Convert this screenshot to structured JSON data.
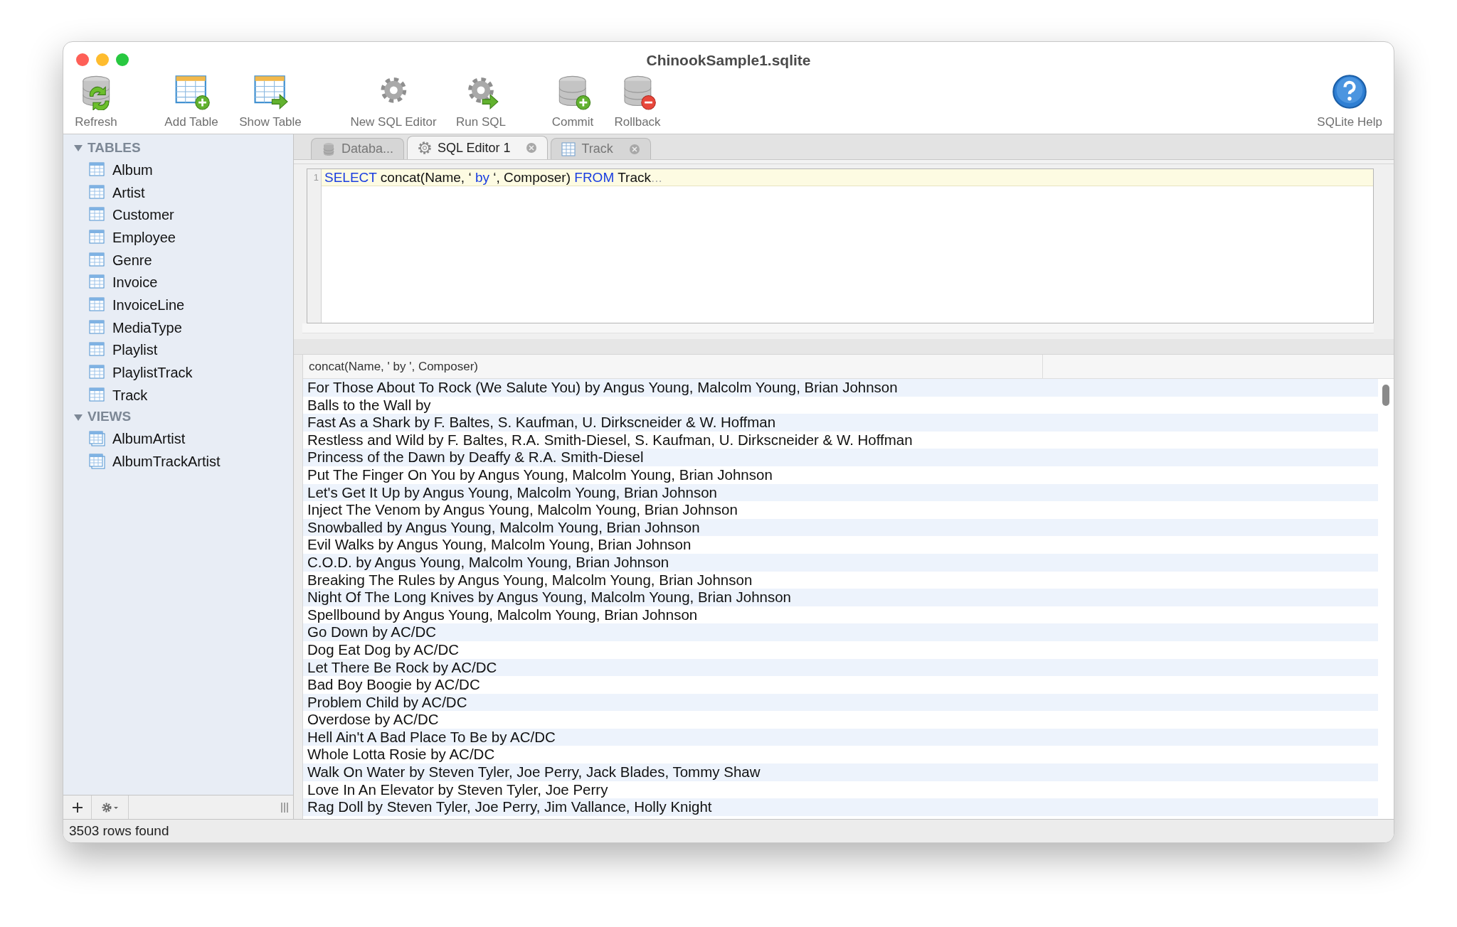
{
  "window": {
    "title": "ChinookSample1.sqlite"
  },
  "toolbar": [
    {
      "label": "Refresh",
      "kind": "refresh"
    },
    {
      "label": "Add Table",
      "kind": "add-table"
    },
    {
      "label": "Show Table",
      "kind": "show-table"
    },
    {
      "label": "New SQL Editor",
      "kind": "gear"
    },
    {
      "label": "Run SQL",
      "kind": "run"
    },
    {
      "label": "Commit",
      "kind": "commit"
    },
    {
      "label": "Rollback",
      "kind": "rollback"
    },
    {
      "label": "SQLite Help",
      "kind": "help"
    }
  ],
  "sidebar": {
    "sections": [
      {
        "label": "TABLES",
        "kind": "table",
        "expanded": true,
        "items": [
          "Album",
          "Artist",
          "Customer",
          "Employee",
          "Genre",
          "Invoice",
          "InvoiceLine",
          "MediaType",
          "Playlist",
          "PlaylistTrack",
          "Track"
        ]
      },
      {
        "label": "VIEWS",
        "kind": "view",
        "expanded": true,
        "items": [
          "AlbumArtist",
          "AlbumTrackArtist"
        ]
      }
    ]
  },
  "tabs": [
    {
      "label": "Databa...",
      "kind": "database",
      "selected": false,
      "closable": false
    },
    {
      "label": "SQL Editor 1",
      "kind": "editor",
      "selected": true,
      "closable": true
    },
    {
      "label": "Track",
      "kind": "table",
      "selected": false,
      "closable": true
    }
  ],
  "editor": {
    "lines": [
      {
        "number": "1",
        "tokens": [
          {
            "text": "SELECT",
            "kind": "keyword"
          },
          {
            "text": " concat(Name, ‘ ",
            "kind": "plain"
          },
          {
            "text": "by",
            "kind": "keyword"
          },
          {
            "text": " ‘, Composer) ",
            "kind": "plain"
          },
          {
            "text": "FROM",
            "kind": "keyword"
          },
          {
            "text": " Track",
            "kind": "plain"
          },
          {
            "text": "...",
            "kind": "hint"
          }
        ]
      }
    ]
  },
  "results": {
    "columns": [
      "concat(Name, ' by ', Composer)"
    ],
    "rows": [
      "For Those About To Rock (We Salute You) by Angus Young, Malcolm Young, Brian Johnson",
      "Balls to the Wall by",
      "Fast As a Shark by F. Baltes, S. Kaufman, U. Dirkscneider & W. Hoffman",
      "Restless and Wild by F. Baltes, R.A. Smith-Diesel, S. Kaufman, U. Dirkscneider & W. Hoffman",
      "Princess of the Dawn by Deaffy & R.A. Smith-Diesel",
      "Put The Finger On You by Angus Young, Malcolm Young, Brian Johnson",
      "Let's Get It Up by Angus Young, Malcolm Young, Brian Johnson",
      "Inject The Venom by Angus Young, Malcolm Young, Brian Johnson",
      "Snowballed by Angus Young, Malcolm Young, Brian Johnson",
      "Evil Walks by Angus Young, Malcolm Young, Brian Johnson",
      "C.O.D. by Angus Young, Malcolm Young, Brian Johnson",
      "Breaking The Rules by Angus Young, Malcolm Young, Brian Johnson",
      "Night Of The Long Knives by Angus Young, Malcolm Young, Brian Johnson",
      "Spellbound by Angus Young, Malcolm Young, Brian Johnson",
      "Go Down by AC/DC",
      "Dog Eat Dog by AC/DC",
      "Let There Be Rock by AC/DC",
      "Bad Boy Boogie by AC/DC",
      "Problem Child by AC/DC",
      "Overdose by AC/DC",
      "Hell Ain't A Bad Place To Be by AC/DC",
      "Whole Lotta Rosie by AC/DC",
      "Walk On Water by Steven Tyler, Joe Perry, Jack Blades, Tommy Shaw",
      "Love In An Elevator by Steven Tyler, Joe Perry",
      "Rag Doll by Steven Tyler, Joe Perry, Jim Vallance, Holly Knight"
    ]
  },
  "status_bar": "3503 rows found"
}
